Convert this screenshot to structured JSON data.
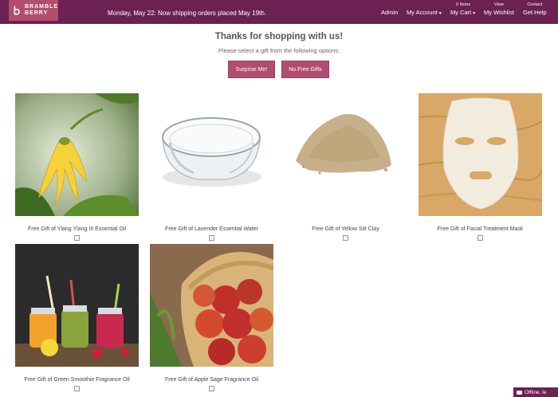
{
  "logo": {
    "line1": "BRAMBLE",
    "line2": "BERRY"
  },
  "announcement": "Monday, May 22: Now shipping orders placed May 19th.",
  "nav": {
    "admin": {
      "sup": "",
      "label": "Admin"
    },
    "account": {
      "sup": "",
      "label": "My Account"
    },
    "cart": {
      "sup": "0 Items",
      "label": "My Cart"
    },
    "wishlist": {
      "sup": "View",
      "label": "My Wishlist"
    },
    "help": {
      "sup": "Contact",
      "label": "Get Help"
    }
  },
  "main": {
    "heading": "Thanks for shopping with us!",
    "subheading": "Please select a gift from the following options:",
    "surprise_button": "Surprise Me!",
    "no_gift_button": "No Free Gifts"
  },
  "products": [
    {
      "name": "Free Gift of Ylang Ylang III Essential Oil"
    },
    {
      "name": "Free Gift of Lavender Essential Water"
    },
    {
      "name": "Free Gift of Yellow Silt Clay"
    },
    {
      "name": "Free Gift of Facial Treatment Mask"
    },
    {
      "name": "Free Gift of Green Smoothie Fragrance Oil"
    },
    {
      "name": "Free Gift of Apple Sage Fragrance Oil"
    }
  ],
  "chat": {
    "label": "Offline, le"
  },
  "colors": {
    "brand": "#6b2152",
    "accent": "#b24d6f"
  }
}
